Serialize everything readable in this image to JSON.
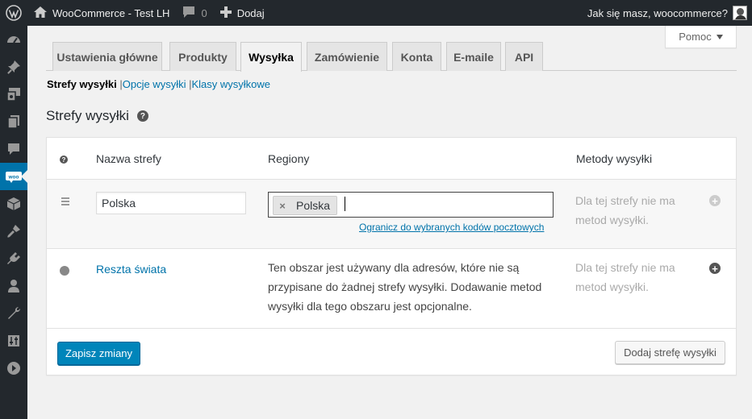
{
  "adminbar": {
    "site_title": "WooCommerce - Test LH",
    "comments_count": "0",
    "new_label": "Dodaj",
    "greeting": "Jak się masz, woocommerce?"
  },
  "help": {
    "label": "Pomoc"
  },
  "tabs": [
    {
      "label": "Ustawienia główne"
    },
    {
      "label": "Produkty"
    },
    {
      "label": "Wysyłka",
      "active": true
    },
    {
      "label": "Zamówienie"
    },
    {
      "label": "Konta"
    },
    {
      "label": "E-maile"
    },
    {
      "label": "API"
    }
  ],
  "subnav": {
    "zones": "Strefy wysyłki",
    "options": "Opcje wysyłki",
    "classes": "Klasy wysyłkowe",
    "separator": "|"
  },
  "page": {
    "title": "Strefy wysyłki",
    "help_symbol": "?"
  },
  "table": {
    "headers": {
      "help_symbol": "?",
      "zone_name": "Nazwa strefy",
      "regions": "Regiony",
      "methods": "Metody wysyłki"
    },
    "zone": {
      "name_value": "Polska",
      "region_chip": "Polska",
      "chip_remove": "×",
      "postcode_link": "Ogranicz do wybranych kodów pocztowych",
      "no_methods": "Dla tej strefy nie ma metod wysyłki."
    },
    "rest": {
      "name": "Reszta świata",
      "description": "Ten obszar jest używany dla adresów, które nie są przypisane do żadnej strefy wysyłki. Dodawanie metod wysyłki dla tego obszaru jest opcjonalne.",
      "no_methods": "Dla tej strefy nie ma metod wysyłki."
    }
  },
  "footer": {
    "save_label": "Zapisz zmiany",
    "add_zone_label": "Dodaj strefę wysyłki"
  },
  "colors": {
    "adminbar": "#23282d",
    "accent": "#0073aa",
    "primary_button": "#0085ba"
  },
  "icons": {
    "sidebar": [
      "dashboard-icon",
      "pin-icon",
      "media-icon",
      "pages-icon",
      "comments-icon",
      "woocommerce-icon",
      "products-icon",
      "appearance-icon",
      "plugins-icon",
      "users-icon",
      "tools-icon",
      "settings-icon",
      "collapse-icon"
    ]
  }
}
